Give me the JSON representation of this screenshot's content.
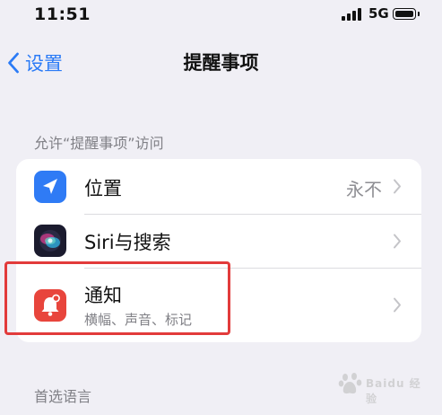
{
  "status_bar": {
    "time": "11:51",
    "network": "5G"
  },
  "nav": {
    "back_label": "设置",
    "title": "提醒事项"
  },
  "sections": [
    {
      "header": "允许“提醒事项”访问",
      "rows": [
        {
          "label": "位置",
          "value": "永不",
          "icon": "location-arrow-icon",
          "icon_color": "#2f7bf5"
        },
        {
          "label": "Siri与搜索",
          "icon": "siri-icon",
          "icon_color": "#1b1b2e"
        },
        {
          "label": "通知",
          "sublabel": "横幅、声音、标记",
          "icon": "notification-bell-icon",
          "icon_color": "#e8453c"
        }
      ]
    },
    {
      "header": "首选语言"
    }
  ],
  "watermark": "Baidu 经验",
  "colors": {
    "accent": "#2b7bf6",
    "highlight": "#e23b3b",
    "background": "#f0eff5"
  }
}
